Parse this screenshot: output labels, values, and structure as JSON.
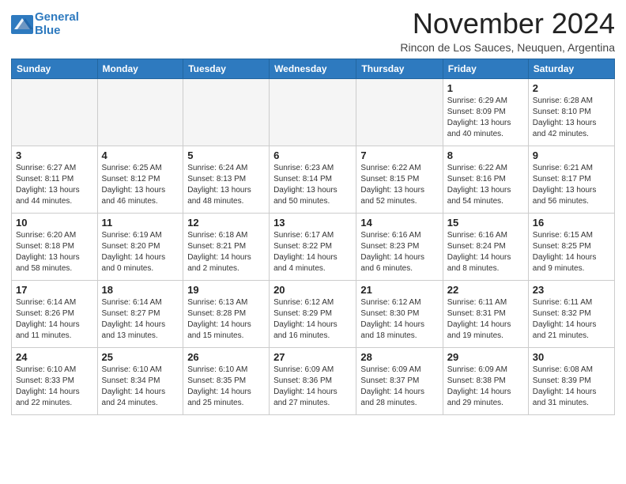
{
  "logo": {
    "line1": "General",
    "line2": "Blue"
  },
  "title": "November 2024",
  "location": "Rincon de Los Sauces, Neuquen, Argentina",
  "weekdays": [
    "Sunday",
    "Monday",
    "Tuesday",
    "Wednesday",
    "Thursday",
    "Friday",
    "Saturday"
  ],
  "weeks": [
    [
      {
        "day": "",
        "info": ""
      },
      {
        "day": "",
        "info": ""
      },
      {
        "day": "",
        "info": ""
      },
      {
        "day": "",
        "info": ""
      },
      {
        "day": "",
        "info": ""
      },
      {
        "day": "1",
        "info": "Sunrise: 6:29 AM\nSunset: 8:09 PM\nDaylight: 13 hours\nand 40 minutes."
      },
      {
        "day": "2",
        "info": "Sunrise: 6:28 AM\nSunset: 8:10 PM\nDaylight: 13 hours\nand 42 minutes."
      }
    ],
    [
      {
        "day": "3",
        "info": "Sunrise: 6:27 AM\nSunset: 8:11 PM\nDaylight: 13 hours\nand 44 minutes."
      },
      {
        "day": "4",
        "info": "Sunrise: 6:25 AM\nSunset: 8:12 PM\nDaylight: 13 hours\nand 46 minutes."
      },
      {
        "day": "5",
        "info": "Sunrise: 6:24 AM\nSunset: 8:13 PM\nDaylight: 13 hours\nand 48 minutes."
      },
      {
        "day": "6",
        "info": "Sunrise: 6:23 AM\nSunset: 8:14 PM\nDaylight: 13 hours\nand 50 minutes."
      },
      {
        "day": "7",
        "info": "Sunrise: 6:22 AM\nSunset: 8:15 PM\nDaylight: 13 hours\nand 52 minutes."
      },
      {
        "day": "8",
        "info": "Sunrise: 6:22 AM\nSunset: 8:16 PM\nDaylight: 13 hours\nand 54 minutes."
      },
      {
        "day": "9",
        "info": "Sunrise: 6:21 AM\nSunset: 8:17 PM\nDaylight: 13 hours\nand 56 minutes."
      }
    ],
    [
      {
        "day": "10",
        "info": "Sunrise: 6:20 AM\nSunset: 8:18 PM\nDaylight: 13 hours\nand 58 minutes."
      },
      {
        "day": "11",
        "info": "Sunrise: 6:19 AM\nSunset: 8:20 PM\nDaylight: 14 hours\nand 0 minutes."
      },
      {
        "day": "12",
        "info": "Sunrise: 6:18 AM\nSunset: 8:21 PM\nDaylight: 14 hours\nand 2 minutes."
      },
      {
        "day": "13",
        "info": "Sunrise: 6:17 AM\nSunset: 8:22 PM\nDaylight: 14 hours\nand 4 minutes."
      },
      {
        "day": "14",
        "info": "Sunrise: 6:16 AM\nSunset: 8:23 PM\nDaylight: 14 hours\nand 6 minutes."
      },
      {
        "day": "15",
        "info": "Sunrise: 6:16 AM\nSunset: 8:24 PM\nDaylight: 14 hours\nand 8 minutes."
      },
      {
        "day": "16",
        "info": "Sunrise: 6:15 AM\nSunset: 8:25 PM\nDaylight: 14 hours\nand 9 minutes."
      }
    ],
    [
      {
        "day": "17",
        "info": "Sunrise: 6:14 AM\nSunset: 8:26 PM\nDaylight: 14 hours\nand 11 minutes."
      },
      {
        "day": "18",
        "info": "Sunrise: 6:14 AM\nSunset: 8:27 PM\nDaylight: 14 hours\nand 13 minutes."
      },
      {
        "day": "19",
        "info": "Sunrise: 6:13 AM\nSunset: 8:28 PM\nDaylight: 14 hours\nand 15 minutes."
      },
      {
        "day": "20",
        "info": "Sunrise: 6:12 AM\nSunset: 8:29 PM\nDaylight: 14 hours\nand 16 minutes."
      },
      {
        "day": "21",
        "info": "Sunrise: 6:12 AM\nSunset: 8:30 PM\nDaylight: 14 hours\nand 18 minutes."
      },
      {
        "day": "22",
        "info": "Sunrise: 6:11 AM\nSunset: 8:31 PM\nDaylight: 14 hours\nand 19 minutes."
      },
      {
        "day": "23",
        "info": "Sunrise: 6:11 AM\nSunset: 8:32 PM\nDaylight: 14 hours\nand 21 minutes."
      }
    ],
    [
      {
        "day": "24",
        "info": "Sunrise: 6:10 AM\nSunset: 8:33 PM\nDaylight: 14 hours\nand 22 minutes."
      },
      {
        "day": "25",
        "info": "Sunrise: 6:10 AM\nSunset: 8:34 PM\nDaylight: 14 hours\nand 24 minutes."
      },
      {
        "day": "26",
        "info": "Sunrise: 6:10 AM\nSunset: 8:35 PM\nDaylight: 14 hours\nand 25 minutes."
      },
      {
        "day": "27",
        "info": "Sunrise: 6:09 AM\nSunset: 8:36 PM\nDaylight: 14 hours\nand 27 minutes."
      },
      {
        "day": "28",
        "info": "Sunrise: 6:09 AM\nSunset: 8:37 PM\nDaylight: 14 hours\nand 28 minutes."
      },
      {
        "day": "29",
        "info": "Sunrise: 6:09 AM\nSunset: 8:38 PM\nDaylight: 14 hours\nand 29 minutes."
      },
      {
        "day": "30",
        "info": "Sunrise: 6:08 AM\nSunset: 8:39 PM\nDaylight: 14 hours\nand 31 minutes."
      }
    ]
  ]
}
